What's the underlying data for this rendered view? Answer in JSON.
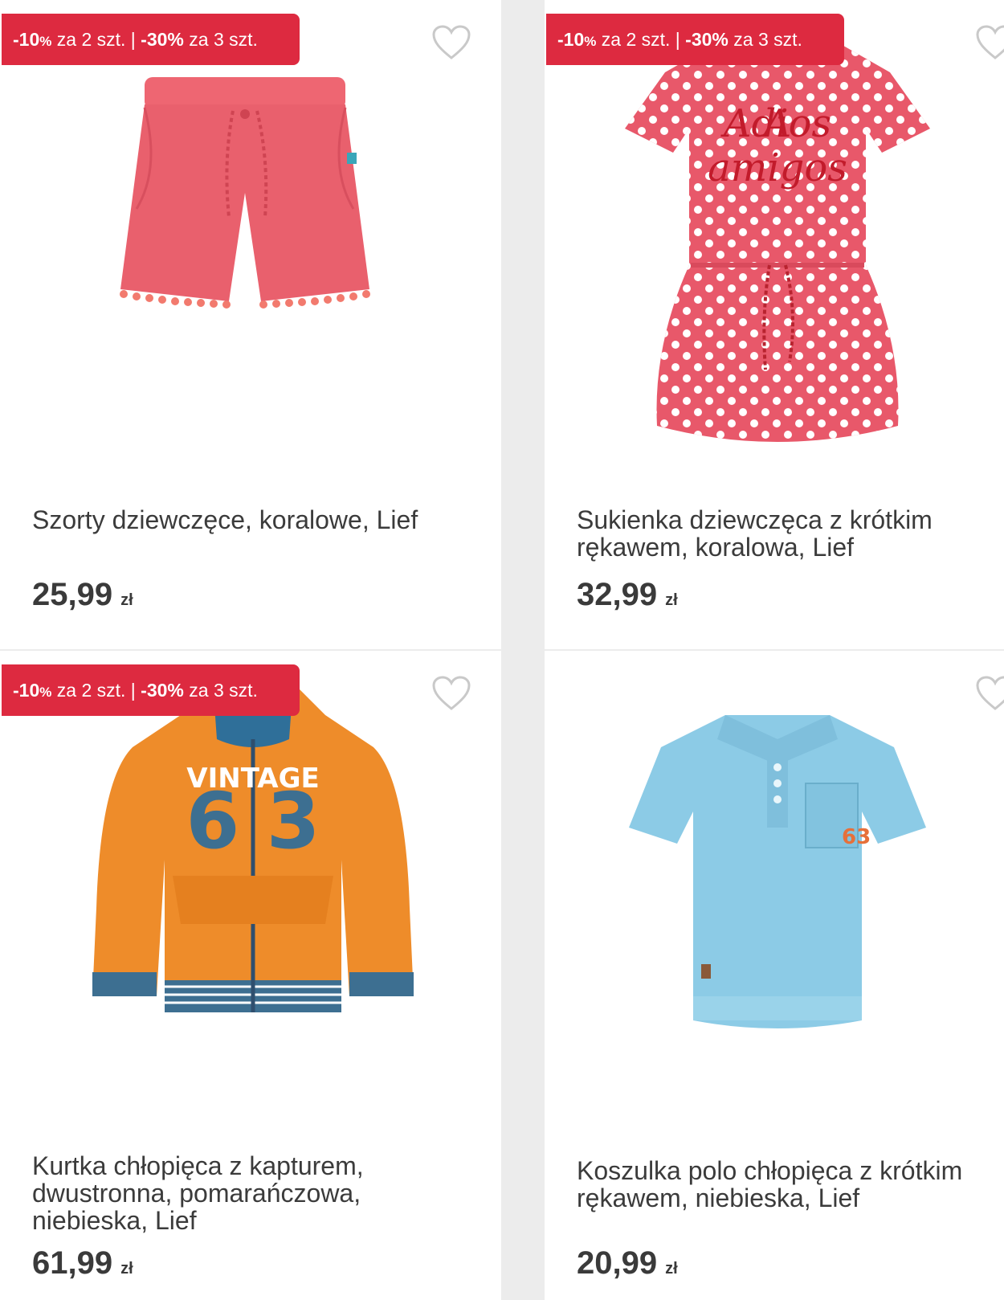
{
  "products": [
    {
      "promo": {
        "part1_value": "-10",
        "part1_unit": "%",
        "part1_text": " za 2 szt. | ",
        "part2_value": "-30%",
        "part2_text": " za 3 szt."
      },
      "title": "Szorty dziewczęce, koralowe, Lief",
      "price": "25,99",
      "currency": "zł",
      "image_icon": "coral-shorts-image"
    },
    {
      "promo": {
        "part1_value": "-10",
        "part1_unit": "%",
        "part1_text": " za 2 szt. | ",
        "part2_value": "-30%",
        "part2_text": " za 3 szt."
      },
      "title": "Sukienka dziewczęca z krótkim rękawem, koralowa, Lief",
      "price": "32,99",
      "currency": "zł",
      "image_icon": "polka-dot-dress-image",
      "image_text": "Adios amigos"
    },
    {
      "promo": {
        "part1_value": "-10",
        "part1_unit": "%",
        "part1_text": " za 2 szt. | ",
        "part2_value": "-30%",
        "part2_text": " za 3 szt."
      },
      "title": "Kurtka chłopięca z kapturem, dwustronna, pomarańczowa, niebieska, Lief",
      "price": "61,99",
      "currency": "zł",
      "image_icon": "orange-hoodie-image",
      "image_text": "VINTAGE 63"
    },
    {
      "title": "Koszulka polo chłopięca z krótkim rękawem, niebieska, Lief",
      "price": "20,99",
      "currency": "zł",
      "image_icon": "blue-polo-image",
      "image_text": "63"
    }
  ],
  "colors": {
    "badge": "#dd2a40",
    "text": "#3b3b3b",
    "heart": "#c9c9c9"
  }
}
